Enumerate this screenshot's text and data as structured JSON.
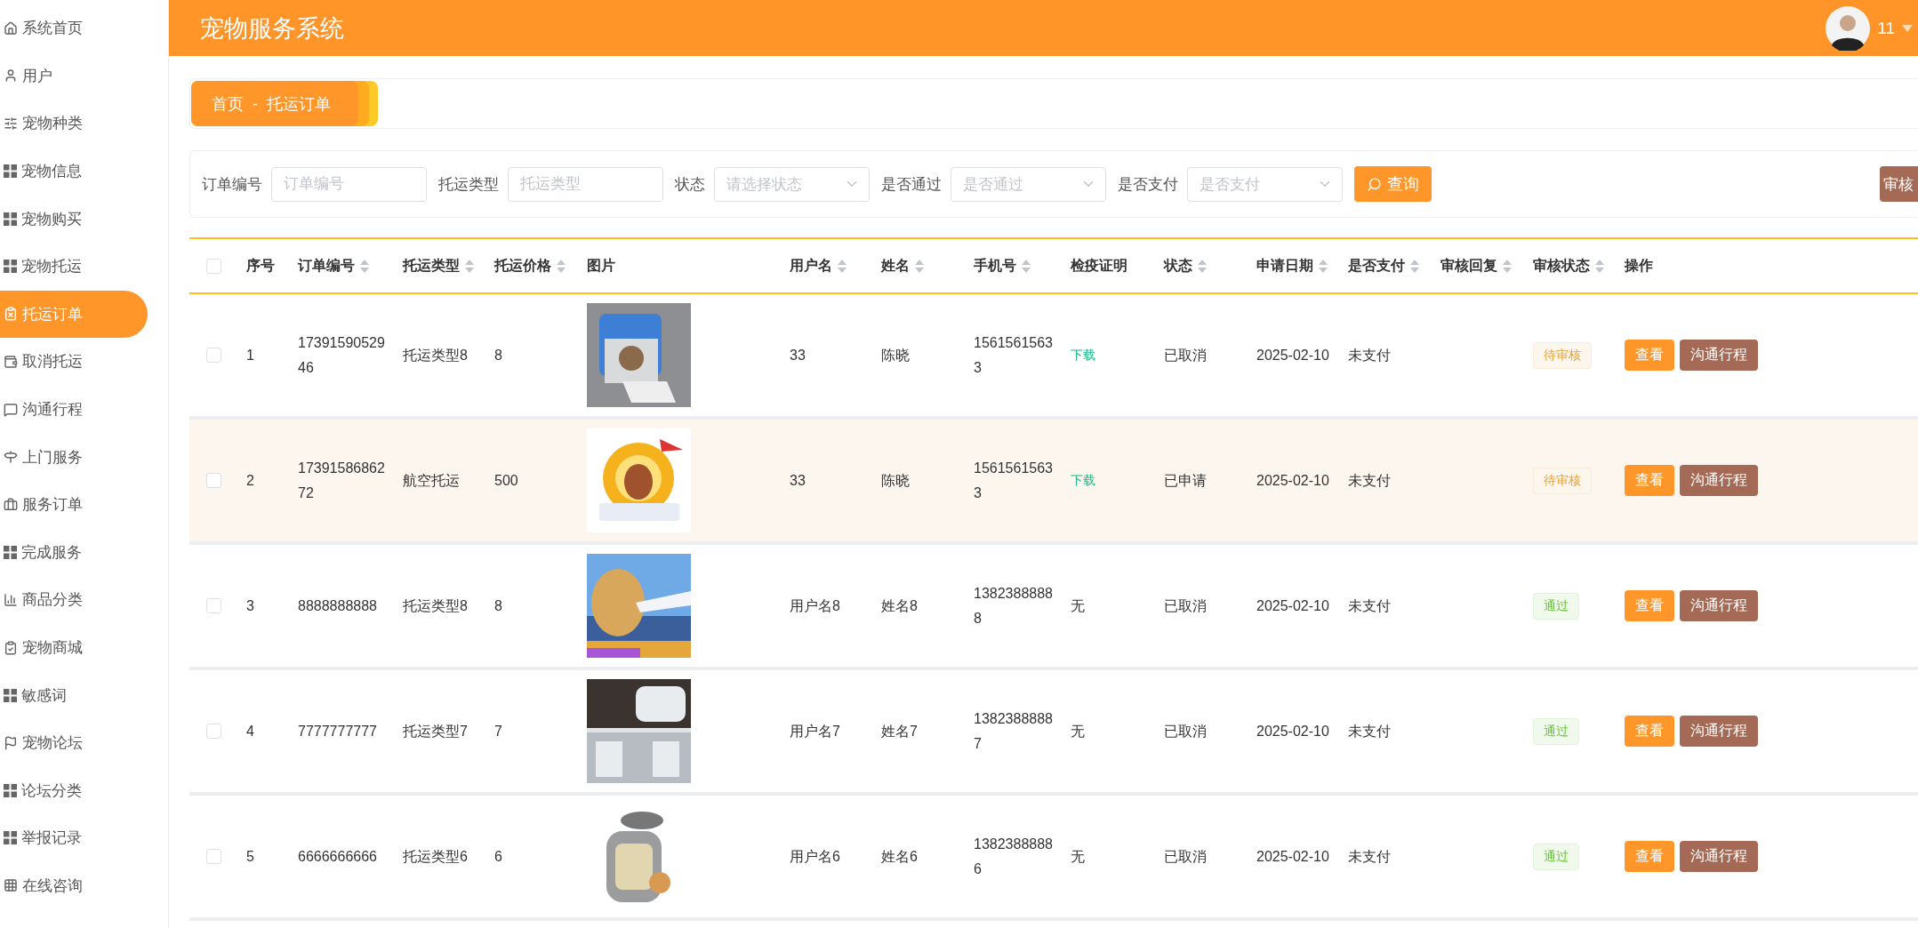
{
  "sidebar": {
    "items": [
      {
        "label": "系统首页",
        "selected": false
      },
      {
        "label": "用户",
        "selected": false
      },
      {
        "label": "宠物种类",
        "selected": false
      },
      {
        "label": "宠物信息",
        "selected": false
      },
      {
        "label": "宠物购买",
        "selected": false
      },
      {
        "label": "宠物托运",
        "selected": false
      },
      {
        "label": "托运订单",
        "selected": true
      },
      {
        "label": "取消托运",
        "selected": false
      },
      {
        "label": "沟通行程",
        "selected": false
      },
      {
        "label": "上门服务",
        "selected": false
      },
      {
        "label": "服务订单",
        "selected": false
      },
      {
        "label": "完成服务",
        "selected": false
      },
      {
        "label": "商品分类",
        "selected": false
      },
      {
        "label": "宠物商城",
        "selected": false
      },
      {
        "label": "敏感词",
        "selected": false
      },
      {
        "label": "宠物论坛",
        "selected": false
      },
      {
        "label": "论坛分类",
        "selected": false
      },
      {
        "label": "举报记录",
        "selected": false
      },
      {
        "label": "在线咨询",
        "selected": false
      }
    ]
  },
  "header": {
    "title": "宠物服务系统",
    "user": "11"
  },
  "breadcrumb": "首页  -  托运订单",
  "filters": {
    "fields": [
      {
        "label": "订单编号",
        "placeholder": "订单编号",
        "kind": "input"
      },
      {
        "label": "托运类型",
        "placeholder": "托运类型",
        "kind": "input"
      },
      {
        "label": "状态",
        "placeholder": "请选择状态",
        "kind": "select"
      },
      {
        "label": "是否通过",
        "placeholder": "是否通过",
        "kind": "select"
      },
      {
        "label": "是否支付",
        "placeholder": "是否支付",
        "kind": "select"
      }
    ],
    "search_button": "查询",
    "review_button": "审核"
  },
  "table": {
    "select_all": {
      "checked": false
    },
    "columns": [
      {
        "label": "序号",
        "sortable": false
      },
      {
        "label": "订单编号",
        "sortable": true
      },
      {
        "label": "托运类型",
        "sortable": true
      },
      {
        "label": "托运价格",
        "sortable": true
      },
      {
        "label": "图片",
        "sortable": false
      },
      {
        "label": "用户名",
        "sortable": true
      },
      {
        "label": "姓名",
        "sortable": true
      },
      {
        "label": "手机号",
        "sortable": true
      },
      {
        "label": "检疫证明",
        "sortable": false
      },
      {
        "label": "状态",
        "sortable": true
      },
      {
        "label": "申请日期",
        "sortable": true
      },
      {
        "label": "是否支付",
        "sortable": true
      },
      {
        "label": "审核回复",
        "sortable": true
      },
      {
        "label": "审核状态",
        "sortable": true
      },
      {
        "label": "操作",
        "sortable": false
      }
    ],
    "rows": [
      {
        "checked": false,
        "highlighted": false,
        "index": "1",
        "order_no": "1739159052946",
        "type": "托运类型8",
        "price": "8",
        "username": "33",
        "name": "陈晓",
        "phone": "15615615633",
        "quarantine": {
          "kind": "link",
          "text": "下载"
        },
        "status": "已取消",
        "date": "2025-02-10",
        "paid": "未支付",
        "review": {
          "kind": "pending",
          "text": "待审核"
        },
        "actions": [
          "查看",
          "沟通行程"
        ]
      },
      {
        "checked": false,
        "highlighted": true,
        "index": "2",
        "order_no": "1739158686272",
        "type": "航空托运",
        "price": "500",
        "username": "33",
        "name": "陈晓",
        "phone": "15615615633",
        "quarantine": {
          "kind": "link",
          "text": "下载"
        },
        "status": "已申请",
        "date": "2025-02-10",
        "paid": "未支付",
        "review": {
          "kind": "pending",
          "text": "待审核"
        },
        "actions": [
          "查看",
          "沟通行程"
        ]
      },
      {
        "checked": false,
        "highlighted": false,
        "index": "3",
        "order_no": "8888888888",
        "type": "托运类型8",
        "price": "8",
        "username": "用户名8",
        "name": "姓名8",
        "phone": "13823888888",
        "quarantine": {
          "kind": "text",
          "text": "无"
        },
        "status": "已取消",
        "date": "2025-02-10",
        "paid": "未支付",
        "review": {
          "kind": "passed",
          "text": "通过"
        },
        "actions": [
          "查看",
          "沟通行程"
        ]
      },
      {
        "checked": false,
        "highlighted": false,
        "index": "4",
        "order_no": "7777777777",
        "type": "托运类型7",
        "price": "7",
        "username": "用户名7",
        "name": "姓名7",
        "phone": "13823888887",
        "quarantine": {
          "kind": "text",
          "text": "无"
        },
        "status": "已取消",
        "date": "2025-02-10",
        "paid": "未支付",
        "review": {
          "kind": "passed",
          "text": "通过"
        },
        "actions": [
          "查看",
          "沟通行程"
        ]
      },
      {
        "checked": false,
        "highlighted": false,
        "index": "5",
        "order_no": "6666666666",
        "type": "托运类型6",
        "price": "6",
        "username": "用户名6",
        "name": "姓名6",
        "phone": "13823888886",
        "quarantine": {
          "kind": "text",
          "text": "无"
        },
        "status": "已取消",
        "date": "2025-02-10",
        "paid": "未支付",
        "review": {
          "kind": "passed",
          "text": "通过"
        },
        "actions": [
          "查看",
          "沟通行程"
        ]
      }
    ]
  }
}
